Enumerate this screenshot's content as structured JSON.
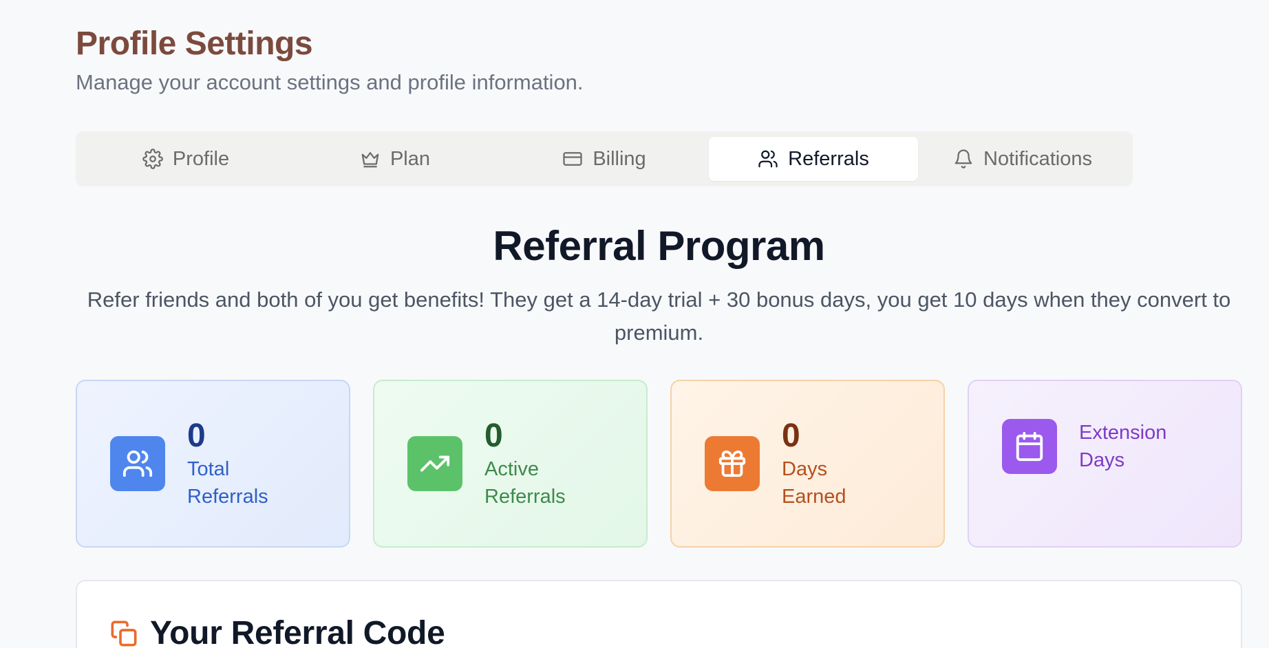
{
  "header": {
    "title": "Profile Settings",
    "subtitle": "Manage your account settings and profile information."
  },
  "tabs": [
    {
      "label": "Profile",
      "icon": "gear-icon",
      "active": false
    },
    {
      "label": "Plan",
      "icon": "crown-icon",
      "active": false
    },
    {
      "label": "Billing",
      "icon": "credit-card-icon",
      "active": false
    },
    {
      "label": "Referrals",
      "icon": "users-icon",
      "active": true
    },
    {
      "label": "Notifications",
      "icon": "bell-icon",
      "active": false
    }
  ],
  "referral": {
    "title": "Referral Program",
    "description": "Refer friends and both of you get benefits! They get a 14-day trial + 30 bonus days, you get 10 days when they convert to premium."
  },
  "stats": [
    {
      "value": "0",
      "label": "Total Referrals",
      "icon": "users-icon",
      "color": "#4f86ee"
    },
    {
      "value": "0",
      "label": "Active Referrals",
      "icon": "trending-up-icon",
      "color": "#5cc26a"
    },
    {
      "value": "0",
      "label": "Days Earned",
      "icon": "gift-icon",
      "color": "#ec7a33"
    },
    {
      "value": "",
      "label": "Extension Days",
      "icon": "calendar-icon",
      "color": "#9b59ee"
    }
  ],
  "code_card": {
    "title": "Your Referral Code",
    "icon": "copy-icon"
  }
}
